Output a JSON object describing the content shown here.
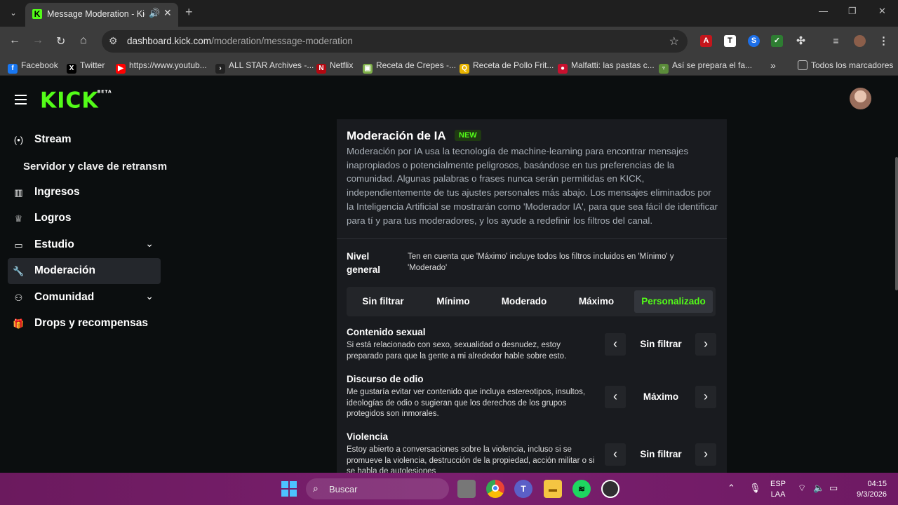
{
  "browser": {
    "tab_title": "Message Moderation - Kick",
    "tab_favicon": "K",
    "url_host": "dashboard.kick.com",
    "url_path": "/moderation/message-moderation",
    "bookmarks": [
      {
        "label": "Facebook",
        "icon": "facebook-icon",
        "color": "#1877f2",
        "glyph": "f"
      },
      {
        "label": "Twitter",
        "icon": "x-icon",
        "color": "#000000",
        "glyph": "X"
      },
      {
        "label": "https://www.youtub...",
        "icon": "youtube-icon",
        "color": "#ff0000",
        "glyph": "▶"
      },
      {
        "label": "ALL STAR Archives -...",
        "icon": "allstar-icon",
        "color": "#222222",
        "glyph": "›"
      },
      {
        "label": "Netflix",
        "icon": "netflix-icon",
        "color": "#b20710",
        "glyph": "N"
      },
      {
        "label": "Receta de Crepes -...",
        "icon": "recipe-icon",
        "color": "#7fb04a",
        "glyph": "▣"
      },
      {
        "label": "Receta de Pollo Frit...",
        "icon": "q-icon",
        "color": "#e8b400",
        "glyph": "Q"
      },
      {
        "label": "Malfatti: las pastas c...",
        "icon": "malfatti-icon",
        "color": "#c8102e",
        "glyph": "●"
      },
      {
        "label": "Así se prepara el fa...",
        "icon": "trophy-icon",
        "color": "#5b8c3a",
        "glyph": "♆"
      }
    ],
    "all_bookmarks": "Todos los marcadores"
  },
  "header": {
    "logo": "KICK",
    "logo_beta": "BETA"
  },
  "sidebar": {
    "items": [
      {
        "label": "Stream",
        "icon": "broadcast-icon",
        "glyph": "(•)"
      },
      {
        "label": "Ingresos",
        "icon": "chart-icon",
        "glyph": "▥"
      },
      {
        "label": "Logros",
        "icon": "trophy-icon",
        "glyph": "♕"
      },
      {
        "label": "Estudio",
        "icon": "studio-icon",
        "glyph": "▭"
      },
      {
        "label": "Moderación",
        "icon": "wrench-icon",
        "glyph": "🔧"
      },
      {
        "label": "Comunidad",
        "icon": "community-icon",
        "glyph": "⚇"
      },
      {
        "label": "Drops y recompensas",
        "icon": "gift-icon",
        "glyph": "🎁"
      }
    ],
    "sub_item": "Servidor y clave de retransm"
  },
  "moderation": {
    "title": "Moderación de IA",
    "badge": "NEW",
    "description": "Moderación por IA usa la tecnología de machine-learning para encontrar mensajes inapropiados o potencialmente peligrosos, basándose en tus preferencias de la comunidad. Algunas palabras o frases nunca serán permitidas en KICK, independientemente de tus ajustes personales más abajo. Los mensajes eliminados por la Inteligencia Artificial se mostrarán como 'Moderador IA', para que sea fácil de identificar para tí y para tus moderadores, y los ayude a redefinir los filtros del canal.",
    "nivel_label": "Nivel general",
    "nivel_note": "Ten en cuenta que 'Máximo' incluye todos los filtros incluidos en 'Mínimo' y 'Moderado'",
    "levels": [
      "Sin filtrar",
      "Mínimo",
      "Moderado",
      "Máximo",
      "Personalizado"
    ],
    "selected_level": "Personalizado",
    "categories": [
      {
        "title": "Contenido sexual",
        "description": "Si está relacionado con sexo, sexualidad o desnudez, estoy preparado para que la gente a mi alrededor hable sobre esto.",
        "value": "Sin filtrar"
      },
      {
        "title": "Discurso de odio",
        "description": "Me gustaría evitar ver contenido que incluya estereotipos, insultos, ideologías de odio o sugieran que los derechos de los grupos protegidos son inmorales.",
        "value": "Máximo"
      },
      {
        "title": "Violencia",
        "description": "Estoy abierto a conversaciones sobre la violencia, incluso si se promueve la violencia, destrucción de la propiedad, acción militar o si se habla de autolesiones",
        "value": "Sin filtrar"
      }
    ]
  },
  "taskbar": {
    "search_label": "Buscar",
    "lang_top": "ESP",
    "lang_bottom": "LAA",
    "time": "04:15",
    "date": "9/3/2026"
  },
  "colors": {
    "kick_green": "#53fc18",
    "page_bg": "#0b0e0f",
    "card_bg": "#191b1f"
  }
}
